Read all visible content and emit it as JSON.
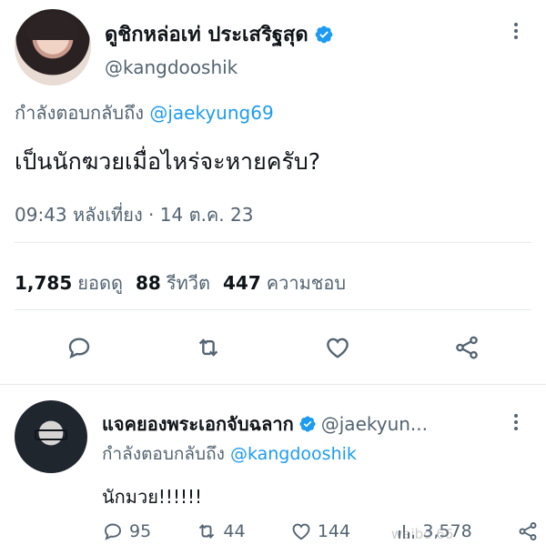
{
  "main_tweet": {
    "author_name": "ดูชิกหล่อเท่ ประเสริฐสุด",
    "author_handle": "@kangdooshik",
    "replying_to_prefix": "กำลังตอบกลับถึง",
    "replying_to_handle": "@jaekyung69",
    "text": "เป็นนักฆวยเมื่อไหร่จะหายครับ?",
    "timestamp": "09:43 หลังเที่ยง · 14 ต.ค. 23",
    "stats": {
      "views_count": "1,785",
      "views_label": "ยอดดู",
      "retweets_count": "88",
      "retweets_label": "รีทวีต",
      "likes_count": "447",
      "likes_label": "ความชอบ"
    }
  },
  "reply_tweet": {
    "author_name": "แจคยองพระเอกจับฉลาก",
    "author_handle": "@jaekyun...",
    "replying_to_prefix": "กำลังตอบกลับถึง",
    "replying_to_handle": "@kangdooshik",
    "text": "นักมวย!!!!!!",
    "replies": "95",
    "retweets": "44",
    "likes": "144",
    "views": "3,578"
  },
  "watermark": "weibo 66",
  "colors": {
    "accent": "#1d9bf0",
    "muted": "#536471",
    "text": "#0f1419"
  },
  "icons": [
    "verified-badge-icon",
    "more-options-icon",
    "reply-icon",
    "retweet-icon",
    "like-icon",
    "share-icon",
    "views-icon"
  ]
}
